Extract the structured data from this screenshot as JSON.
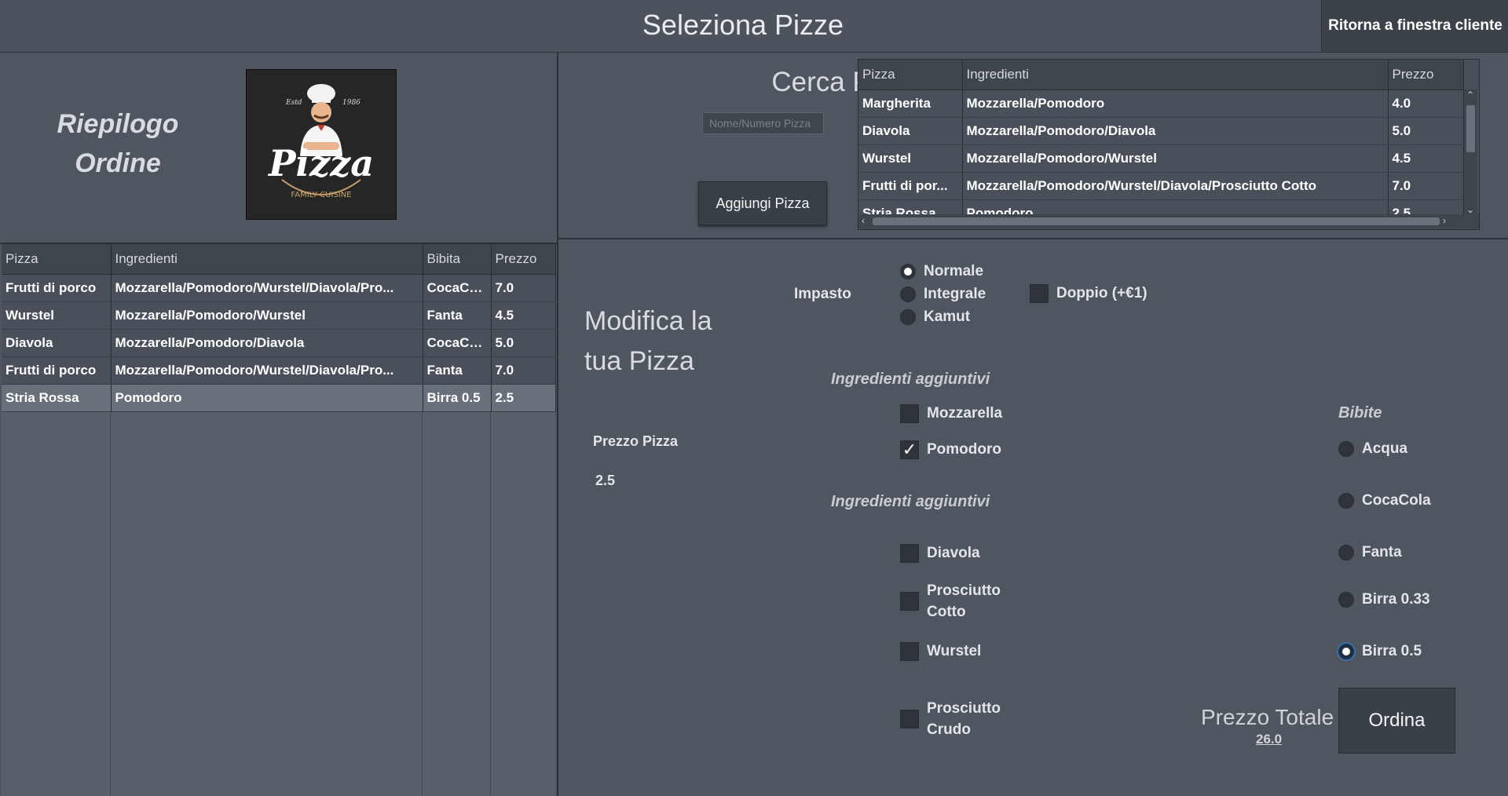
{
  "header": {
    "title": "Seleziona Pizze",
    "back_button": "Ritorna a finestra cliente"
  },
  "summary": {
    "title_line1": "Riepilogo",
    "title_line2": "Ordine",
    "logo": {
      "icon": "pizza-chef-logo",
      "text_main": "Pizza",
      "text_sub": "FAMILY CUISINE",
      "estd": "Estd",
      "year": "1986"
    }
  },
  "order_table": {
    "columns": [
      "Pizza",
      "Ingredienti",
      "Bibita",
      "Prezzo"
    ],
    "rows": [
      [
        "Frutti di porco",
        "Mozzarella/Pomodoro/Wurstel/Diavola/Pro...",
        "CocaCola",
        "7.0"
      ],
      [
        "Wurstel",
        "Mozzarella/Pomodoro/Wurstel",
        "Fanta",
        "4.5"
      ],
      [
        "Diavola",
        "Mozzarella/Pomodoro/Diavola",
        "CocaCola",
        "5.0"
      ],
      [
        "Frutti di porco",
        "Mozzarella/Pomodoro/Wurstel/Diavola/Pro...",
        "Fanta",
        "7.0"
      ],
      [
        "Stria Rossa",
        "Pomodoro",
        "Birra 0.5",
        "2.5"
      ]
    ],
    "selected_row": 4
  },
  "search": {
    "label": "Cerca Pizza",
    "placeholder": "Nome/Numero Pizza",
    "add_button": "Aggiungi Pizza"
  },
  "pizza_table": {
    "columns": [
      "Pizza",
      "Ingredienti",
      "Prezzo"
    ],
    "rows": [
      [
        "Margherita",
        "Mozzarella/Pomodoro",
        "4.0"
      ],
      [
        "Diavola",
        "Mozzarella/Pomodoro/Diavola",
        "5.0"
      ],
      [
        "Wurstel",
        "Mozzarella/Pomodoro/Wurstel",
        "4.5"
      ],
      [
        "Frutti di por...",
        "Mozzarella/Pomodoro/Wurstel/Diavola/Prosciutto Cotto",
        "7.0"
      ],
      [
        "Stria Rossa",
        "Pomodoro",
        "2.5"
      ]
    ]
  },
  "editor": {
    "title_line1": "Modifica la",
    "title_line2": "tua Pizza",
    "price_label": "Prezzo Pizza",
    "price_value": "2.5",
    "impasto_label": "Impasto",
    "impasto_options": [
      "Normale",
      "Integrale",
      "Kamut"
    ],
    "impasto_selected": "Normale",
    "doppio_label": "Doppio (+€1)",
    "doppio_checked": false,
    "extra_label_1": "Ingredienti aggiuntivi",
    "extra_label_2": "Ingredienti aggiuntivi",
    "ingredients": [
      {
        "line1": "Mozzarella",
        "line2": "",
        "checked": false
      },
      {
        "line1": "Pomodoro",
        "line2": "",
        "checked": true
      },
      {
        "line1": "Diavola",
        "line2": "",
        "checked": false
      },
      {
        "line1": "Prosciutto",
        "line2": "Cotto",
        "checked": false
      },
      {
        "line1": "Wurstel",
        "line2": "",
        "checked": false
      },
      {
        "line1": "Prosciutto",
        "line2": "Crudo",
        "checked": false
      }
    ],
    "drinks_label": "Bibite",
    "drinks": [
      "Acqua",
      "CocaCola",
      "Fanta",
      "Birra 0.33",
      "Birra 0.5"
    ],
    "drink_selected": "Birra 0.5",
    "total_label": "Prezzo Totale",
    "total_value": "26.0",
    "order_button": "Ordina"
  }
}
